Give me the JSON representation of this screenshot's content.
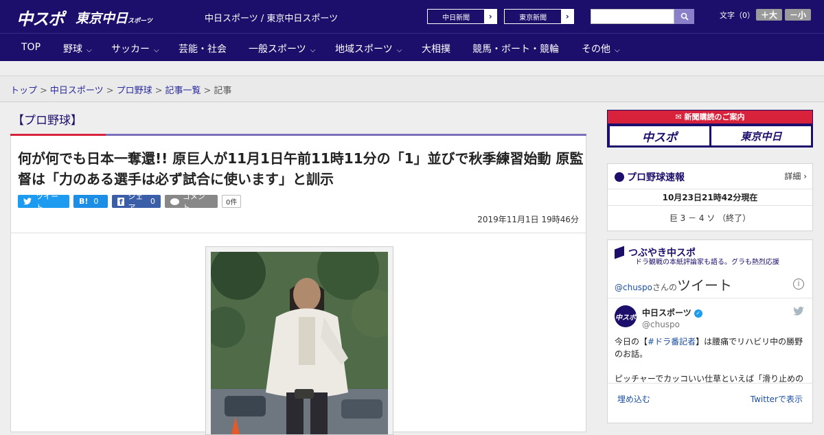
{
  "header": {
    "logo_chuspo": "中スポ",
    "logo_tokyo": "東京中日",
    "logo_tokyo_small": "スポーツ",
    "site_names": "中日スポーツ / 東京中日スポーツ",
    "links": [
      {
        "label": "中日新聞",
        "arrow": "›"
      },
      {
        "label": "東京新聞",
        "arrow": "›"
      }
    ],
    "search_placeholder": "",
    "font_label": "文字（0）",
    "font_up": "＋大",
    "font_down": "－小"
  },
  "nav": {
    "items": [
      {
        "label": "TOP",
        "dropdown": false
      },
      {
        "label": "野球",
        "dropdown": true
      },
      {
        "label": "サッカー",
        "dropdown": true
      },
      {
        "label": "芸能・社会",
        "dropdown": false
      },
      {
        "label": "一般スポーツ",
        "dropdown": true
      },
      {
        "label": "地域スポーツ",
        "dropdown": true
      },
      {
        "label": "大相撲",
        "dropdown": false
      },
      {
        "label": "競馬・ボート・競輪",
        "dropdown": false
      },
      {
        "label": "その他",
        "dropdown": true
      }
    ]
  },
  "breadcrumb": {
    "items": [
      "トップ",
      "中日スポーツ",
      "プロ野球",
      "記事一覧"
    ],
    "current": "記事",
    "separator": ">"
  },
  "section": {
    "title": "【プロ野球】"
  },
  "article": {
    "headline": "何が何でも日本一奪還!! 原巨人が11月1日午前11時11分の「1」並びで秋季練習始動 原監督は「力のある選手は必ず試合に使います」と訓示",
    "share": {
      "tweet": "ツイート",
      "hatena_label": "B!",
      "hatena_count": "0",
      "facebook": "シェア",
      "facebook_count": "0",
      "comment": "コメント",
      "comment_count": "0件"
    },
    "date": "2019年11月1日 19時46分"
  },
  "sidebar": {
    "subscription": {
      "header": "新聞購読のご案内",
      "logo1": "中スポ",
      "logo2": "東京中日"
    },
    "baseball_score": {
      "title": "プロ野球速報",
      "detail": "詳細 ›",
      "timestamp": "10月23日21時42分現在",
      "score": "巨 3 － 4 ソ （終了）"
    },
    "twitter": {
      "title": "つぶやき中スポ",
      "subtitle": "ドラ観戦の本紙評論家も語る。グラも熱烈応援",
      "handle": "@chuspo",
      "handle_suffix": "さんの",
      "tweets_label": "ツイート",
      "account_name": "中日スポーツ",
      "account_handle": "@chuspo",
      "avatar_text": "中スポ",
      "tweet_pre": "今日の【",
      "tweet_tag": "#ドラ番記者",
      "tweet_post": "】は腰痛でリハビリ中の勝野のお話。",
      "tweet_line2": "ピッチャーでカッコいい仕草といえば「滑り止めの",
      "embed": "埋め込む",
      "view_on": "Twitterで表示"
    }
  },
  "colors": {
    "brand": "#1c0e6b",
    "accent_red": "#d8213a",
    "link": "#1c4fa0"
  }
}
